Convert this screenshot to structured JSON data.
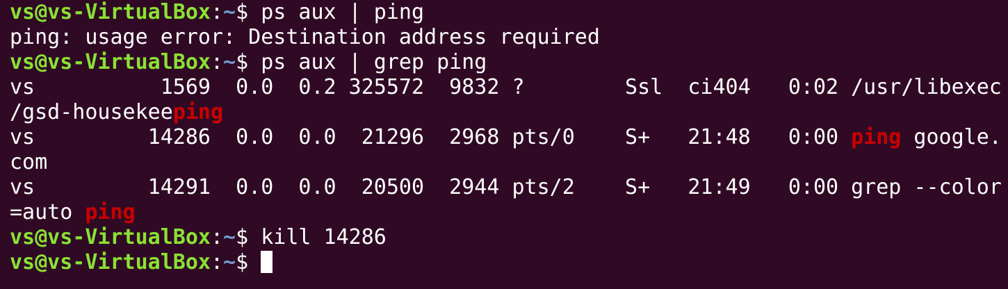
{
  "prompt": {
    "user_host": "vs@vs-VirtualBox",
    "separator": ":",
    "path": "~",
    "sign": "$ "
  },
  "colors": {
    "background": "#300a24",
    "text": "#ffffff",
    "prompt_user": "#8ae234",
    "prompt_path": "#729fcf",
    "grep_match": "#cc0000"
  },
  "lines": {
    "cmd1": "ps aux | ping",
    "out1": "ping: usage error: Destination address required",
    "cmd2": "ps aux | grep ping",
    "row1_a": "vs          1569  0.0  0.2 325572  9832 ?        Ssl  сі404   0:02 /usr/libexec",
    "row1_b_pre": "/gsd-housekee",
    "row1_b_match": "ping",
    "row2_a_pre": "vs         14286  0.0  0.0  21296  2968 pts/0    S+   21:48   0:00 ",
    "row2_a_match": "ping",
    "row2_a_post": " google.",
    "row2_b": "com",
    "row3_a": "vs         14291  0.0  0.0  20500  2944 pts/2    S+   21:49   0:00 grep --color",
    "row3_b_pre": "=auto ",
    "row3_b_match": "ping",
    "cmd3": "kill 14286",
    "cmd4": ""
  }
}
